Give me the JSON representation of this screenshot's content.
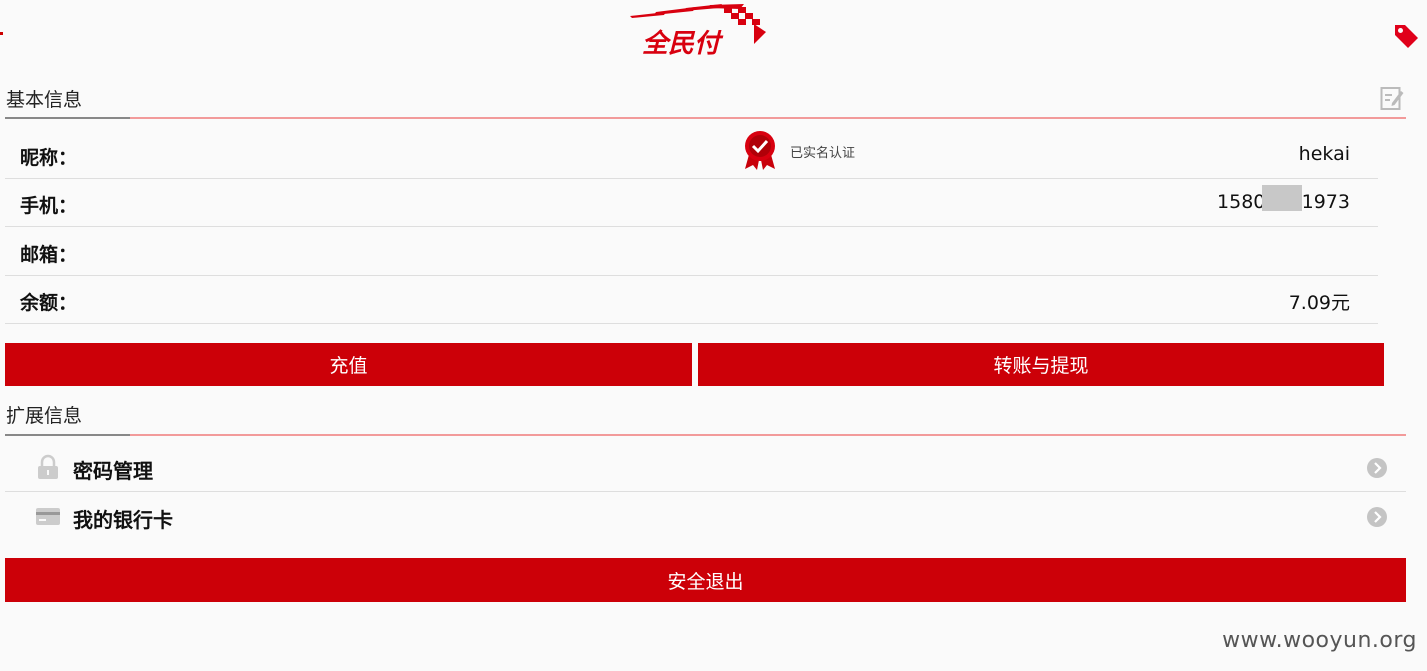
{
  "header": {
    "logo_text": "全民付"
  },
  "basic_info": {
    "title": "基本信息",
    "verified_text": "已实名认证",
    "rows": [
      {
        "label": "昵称：",
        "value": "hekai"
      },
      {
        "label": "手机：",
        "value": "15800    1973"
      },
      {
        "label": "邮箱：",
        "value": ""
      },
      {
        "label": "余额：",
        "value": "7.09元"
      }
    ]
  },
  "actions": {
    "recharge": "充值",
    "transfer": "转账与提现"
  },
  "ext_info": {
    "title": "扩展信息",
    "items": [
      {
        "label": "密码管理",
        "icon": "lock-icon"
      },
      {
        "label": "我的银行卡",
        "icon": "card-icon"
      }
    ]
  },
  "logout": "安全退出",
  "watermark": "www.wooyun.org",
  "colors": {
    "accent": "#cc0008",
    "divider": "#f29a9a"
  }
}
